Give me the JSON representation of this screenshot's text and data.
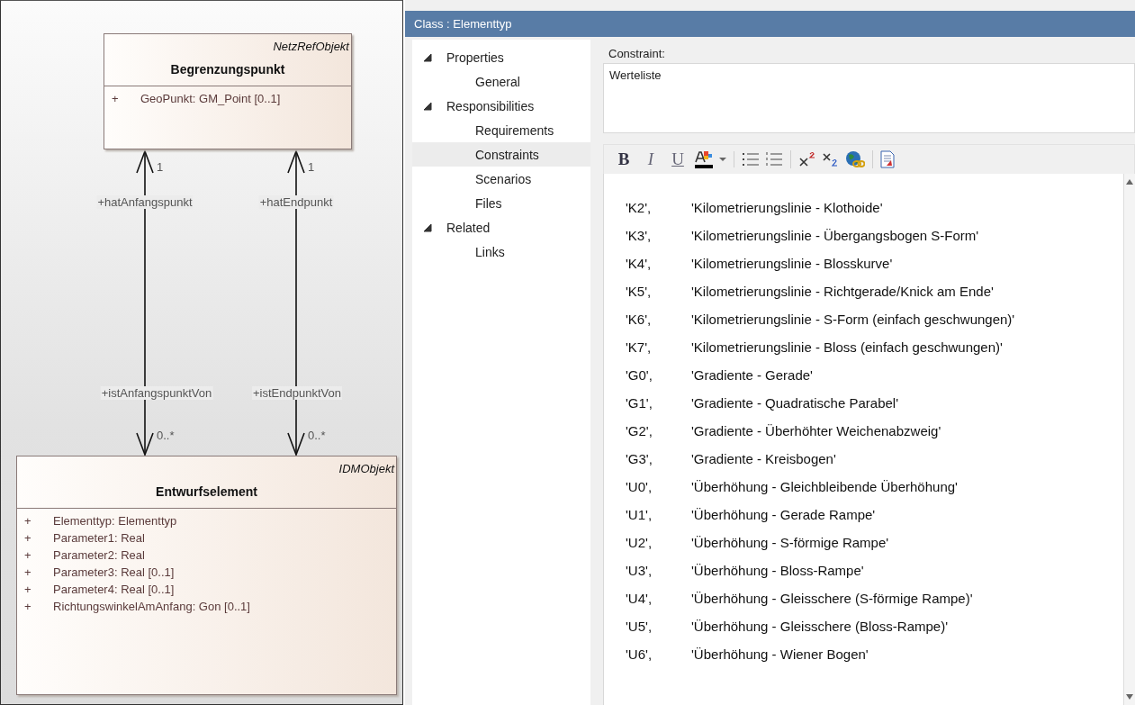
{
  "diagram": {
    "classes": [
      {
        "stereotype": "NetzRefObjekt",
        "name": "Begrenzungspunkt",
        "attributes": [
          {
            "visibility": "+",
            "text": "GeoPunkt: GM_Point [0..1]"
          }
        ]
      },
      {
        "stereotype": "IDMObjekt",
        "name": "Entwurfselement",
        "attributes": [
          {
            "visibility": "+",
            "text": "Elementtyp: Elementtyp"
          },
          {
            "visibility": "+",
            "text": "Parameter1: Real"
          },
          {
            "visibility": "+",
            "text": "Parameter2: Real"
          },
          {
            "visibility": "+",
            "text": "Parameter3: Real [0..1]"
          },
          {
            "visibility": "+",
            "text": "Parameter4: Real [0..1]"
          },
          {
            "visibility": "+",
            "text": "RichtungswinkelAmAnfang: Gon [0..1]"
          }
        ]
      }
    ],
    "associations": [
      {
        "source_role": "+hatAnfangspunkt",
        "source_multiplicity": "1",
        "target_role": "+istAnfangspunktVon",
        "target_multiplicity": "0..*"
      },
      {
        "source_role": "+hatEndpunkt",
        "source_multiplicity": "1",
        "target_role": "+istEndpunktVon",
        "target_multiplicity": "0..*"
      }
    ]
  },
  "dialog": {
    "title": "Class : Elementtyp",
    "tree": [
      {
        "label": "Properties",
        "expanded": true,
        "selected": false,
        "children": [
          {
            "label": "General",
            "selected": false
          }
        ]
      },
      {
        "label": "Responsibilities",
        "expanded": true,
        "selected": false,
        "children": [
          {
            "label": "Requirements",
            "selected": false
          },
          {
            "label": "Constraints",
            "selected": true
          },
          {
            "label": "Scenarios",
            "selected": false
          },
          {
            "label": "Files",
            "selected": false
          }
        ]
      },
      {
        "label": "Related",
        "expanded": true,
        "selected": false,
        "children": [
          {
            "label": "Links",
            "selected": false
          }
        ]
      }
    ],
    "constraint": {
      "label": "Constraint:",
      "value": "Werteliste"
    },
    "toolbar": [
      [
        {
          "kind": "bold",
          "label": "B"
        },
        {
          "kind": "italic",
          "label": "I"
        },
        {
          "kind": "underline",
          "label": "U"
        },
        {
          "kind": "color"
        },
        {
          "kind": "dropdown"
        }
      ],
      [
        {
          "kind": "bullets"
        },
        {
          "kind": "numbering"
        }
      ],
      [
        {
          "kind": "superscript"
        },
        {
          "kind": "subscript"
        },
        {
          "kind": "hyperlink"
        }
      ],
      [
        {
          "kind": "document"
        }
      ]
    ],
    "rows": [
      {
        "code": "'K2',",
        "text": "'Kilometrierungslinie - Klothoide'"
      },
      {
        "code": "'K3',",
        "text": "'Kilometrierungslinie - Übergangsbogen S-Form'"
      },
      {
        "code": "'K4',",
        "text": "'Kilometrierungslinie - Blosskurve'"
      },
      {
        "code": "'K5',",
        "text": "'Kilometrierungslinie - Richtgerade/Knick am Ende'"
      },
      {
        "code": "'K6',",
        "text": "'Kilometrierungslinie - S-Form (einfach geschwungen)'"
      },
      {
        "code": "'K7',",
        "text": "'Kilometrierungslinie - Bloss (einfach geschwungen)'"
      },
      {
        "code": "'G0',",
        "text": "'Gradiente - Gerade'"
      },
      {
        "code": "'G1',",
        "text": "'Gradiente - Quadratische Parabel'"
      },
      {
        "code": "'G2',",
        "text": "'Gradiente - Überhöhter Weichenabzweig'"
      },
      {
        "code": "'G3',",
        "text": "'Gradiente - Kreisbogen'"
      },
      {
        "code": "'U0',",
        "text": "'Überhöhung - Gleichbleibende Überhöhung'"
      },
      {
        "code": "'U1',",
        "text": "'Überhöhung - Gerade Rampe'"
      },
      {
        "code": "'U2',",
        "text": "'Überhöhung - S-förmige Rampe'"
      },
      {
        "code": "'U3',",
        "text": "'Überhöhung - Bloss-Rampe'"
      },
      {
        "code": "'U4',",
        "text": "'Überhöhung - Gleisschere (S-förmige Rampe)'"
      },
      {
        "code": "'U5',",
        "text": "'Überhöhung - Gleisschere (Bloss-Rampe)'"
      },
      {
        "code": "'U6',",
        "text": "'Überhöhung - Wiener Bogen'"
      }
    ]
  }
}
